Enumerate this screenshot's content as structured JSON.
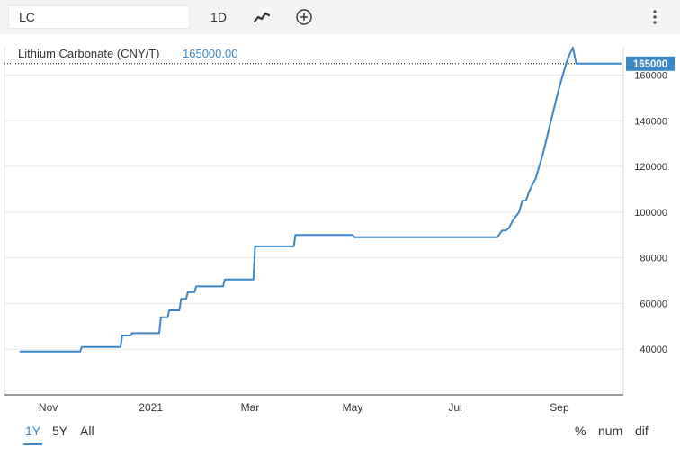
{
  "toolbar": {
    "symbol": "LC",
    "interval": "1D",
    "chart_style_icon": "line-chart-icon",
    "add_icon": "plus-circle-icon",
    "menu_icon": "kebab-menu-icon"
  },
  "legend": {
    "name": "Lithium Carbonate (CNY/T)",
    "value": "165000.00",
    "color": "#3b87c7"
  },
  "last_price_label": "165000",
  "ranges": [
    "1Y",
    "5Y",
    "All"
  ],
  "active_range": "1Y",
  "modes": [
    "%",
    "num",
    "dif"
  ],
  "chart_data": {
    "type": "line",
    "title": "",
    "xlabel": "",
    "ylabel": "",
    "grid": true,
    "y_axis_position": "right",
    "x_tick_labels": [
      "Nov",
      "2021",
      "Mar",
      "May",
      "Jul",
      "Sep"
    ],
    "y_tick_labels": [
      "40000",
      "60000",
      "80000",
      "100000",
      "120000",
      "140000",
      "160000"
    ],
    "ylim": [
      20000,
      172000
    ],
    "series": [
      {
        "name": "Lithium Carbonate (CNY/T)",
        "color": "#3b87c7",
        "x": [
          "2020-10-15",
          "2020-11-20",
          "2020-11-21",
          "2020-12-14",
          "2020-12-15",
          "2020-12-20",
          "2020-12-21",
          "2021-01-06",
          "2021-01-07",
          "2021-01-11",
          "2021-01-12",
          "2021-01-18",
          "2021-01-19",
          "2021-01-22",
          "2021-01-23",
          "2021-01-27",
          "2021-01-28",
          "2021-02-13",
          "2021-02-14",
          "2021-03-03",
          "2021-03-04",
          "2021-03-27",
          "2021-03-28",
          "2021-05-01",
          "2021-05-02",
          "2021-07-26",
          "2021-07-27",
          "2021-07-28",
          "2021-07-29",
          "2021-07-31",
          "2021-08-02",
          "2021-08-04",
          "2021-08-06",
          "2021-08-08",
          "2021-08-10",
          "2021-08-12",
          "2021-08-14",
          "2021-08-16",
          "2021-08-18",
          "2021-08-20",
          "2021-08-22",
          "2021-08-24",
          "2021-08-26",
          "2021-08-28",
          "2021-08-30",
          "2021-09-01",
          "2021-09-03",
          "2021-09-05",
          "2021-09-07",
          "2021-09-09",
          "2021-09-11",
          "2021-09-13",
          "2021-09-15",
          "2021-09-17",
          "2021-09-19",
          "2021-09-21",
          "2021-09-23",
          "2021-09-25",
          "2021-09-27",
          "2021-09-28",
          "2021-09-29",
          "2021-10-02",
          "2021-10-08"
        ],
        "values": [
          39000,
          39000,
          41000,
          41000,
          46000,
          46000,
          47000,
          47000,
          54000,
          54000,
          57000,
          57000,
          62000,
          62000,
          65000,
          65000,
          67500,
          67500,
          70500,
          70500,
          85000,
          85000,
          90000,
          90000,
          89000,
          89000,
          90000,
          91000,
          92000,
          92000,
          93000,
          96000,
          98000,
          100000,
          105000,
          105000,
          109000,
          112000,
          115000,
          120000,
          125000,
          131000,
          137000,
          143000,
          149000,
          155000,
          160000,
          165000,
          169000,
          172000,
          165000,
          165000,
          165000,
          165000,
          165000,
          165000,
          165000,
          165000,
          165000,
          165000,
          165000,
          165000,
          165000
        ]
      }
    ]
  }
}
